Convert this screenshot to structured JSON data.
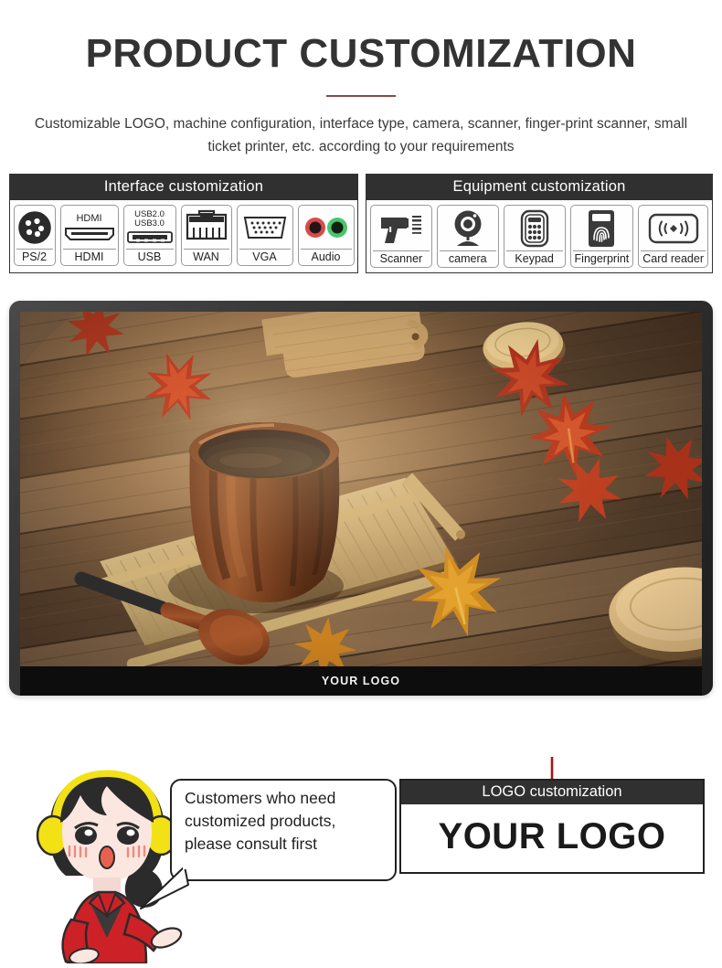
{
  "header": {
    "title": "PRODUCT CUSTOMIZATION",
    "subtitle": "Customizable LOGO, machine configuration, interface type, camera, scanner, finger-print scanner, small ticket printer, etc. according to your requirements",
    "rule_color": "#8a4a42"
  },
  "panels": [
    {
      "id": "interface",
      "title": "Interface customization",
      "items": [
        {
          "label": "PS/2",
          "icon": "ps2-port-icon",
          "caption": ""
        },
        {
          "label": "HDMI",
          "icon": "hdmi-port-icon",
          "caption": "HDMI"
        },
        {
          "label": "USB",
          "icon": "usb-port-icon",
          "caption": "USB2.0\nUSB3.0"
        },
        {
          "label": "WAN",
          "icon": "rj45-port-icon",
          "caption": ""
        },
        {
          "label": "VGA",
          "icon": "vga-port-icon",
          "caption": ""
        },
        {
          "label": "Audio",
          "icon": "audio-jack-icon",
          "caption": ""
        }
      ]
    },
    {
      "id": "equipment",
      "title": "Equipment customization",
      "items": [
        {
          "label": "Scanner",
          "icon": "barcode-scanner-icon"
        },
        {
          "label": "camera",
          "icon": "webcam-icon"
        },
        {
          "label": "Keypad",
          "icon": "keypad-icon"
        },
        {
          "label": "Fingerprint",
          "icon": "fingerprint-reader-icon"
        },
        {
          "label": "Card reader",
          "icon": "rfid-card-reader-icon"
        }
      ]
    }
  ],
  "monitor": {
    "bezel_logo": "YOUR LOGO",
    "screen_description": "wooden cup of tea on bamboo mat with autumn maple leaves on rustic wood table"
  },
  "bottom": {
    "mascot": {
      "name": "customer-service-agent",
      "headset_color": "#f2e215",
      "jacket_color": "#cc2127",
      "hair_color": "#2b2b2b"
    },
    "bubble_lines": [
      "Customers who need",
      "customized products,",
      "please consult first"
    ],
    "logo_box": {
      "header": "LOGO customization",
      "text": "YOUR LOGO"
    },
    "connector_color": "#a81616"
  },
  "colors": {
    "header_bar": "#303030",
    "text": "#2e2e2e",
    "background": "#ffffff",
    "audio_red": "#d84a4a",
    "audio_green": "#4bc46b"
  }
}
